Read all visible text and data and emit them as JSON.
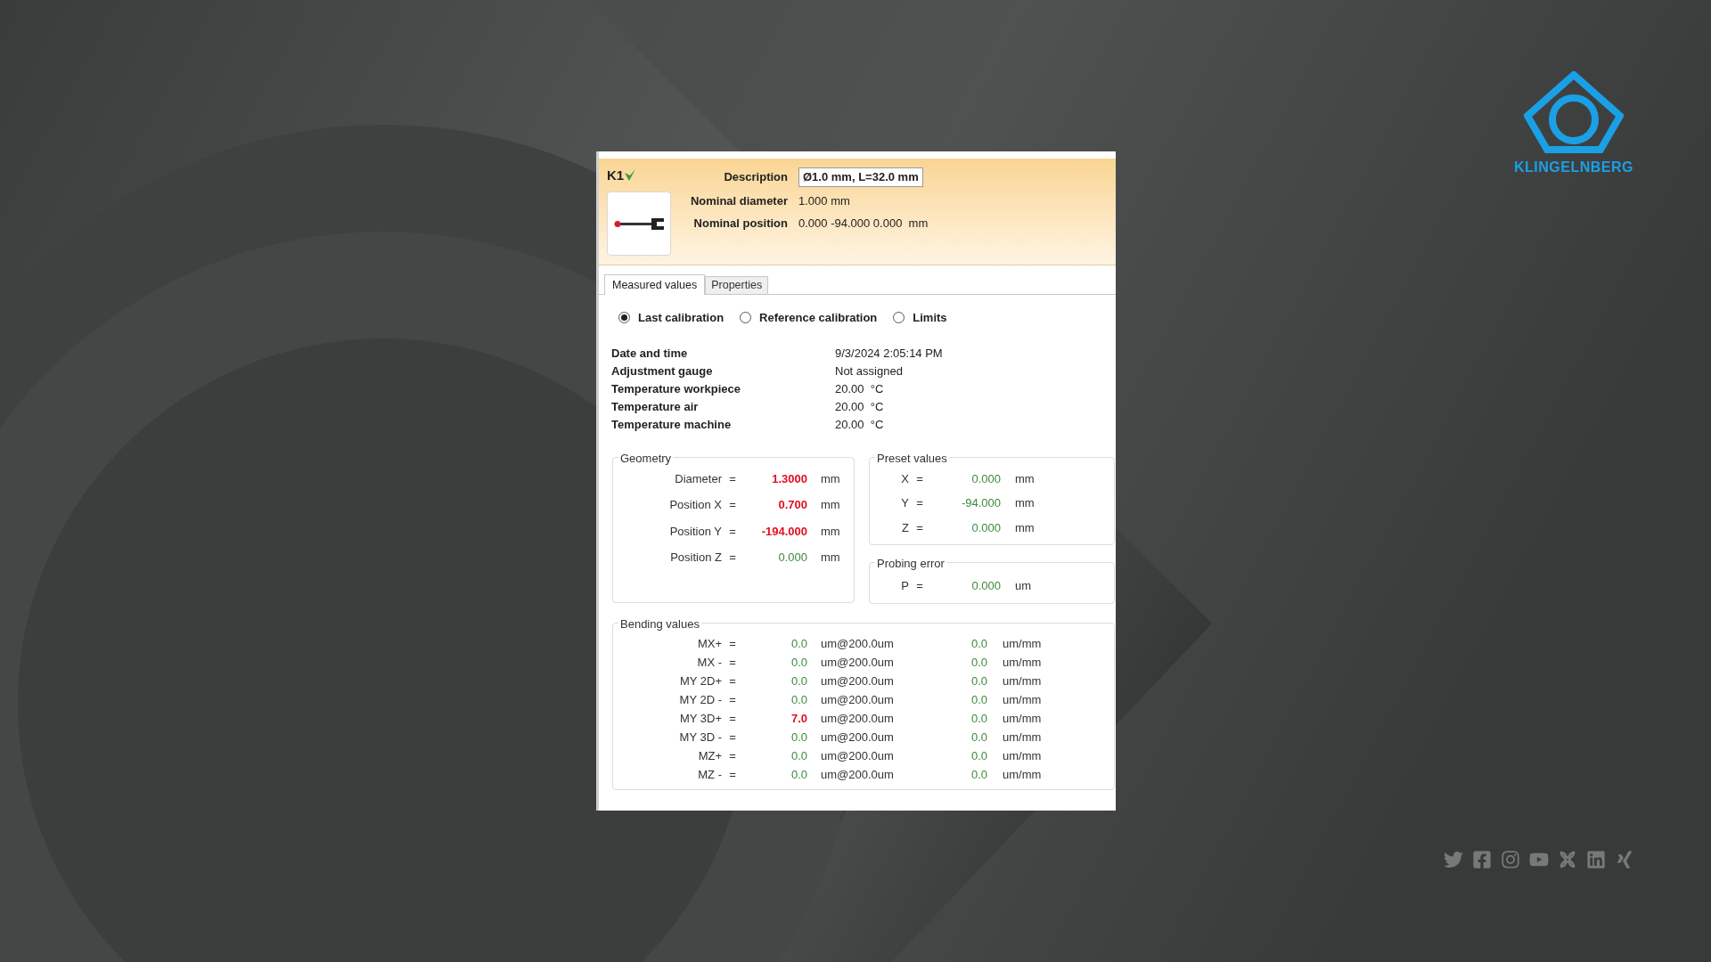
{
  "logo": {
    "text": "KLINGELNBERG"
  },
  "probe": {
    "name": "K1",
    "description_label": "Description",
    "description": "Ø1.0 mm, L=32.0 mm",
    "fields": [
      {
        "label": "Nominal diameter",
        "value": "1.000 mm"
      },
      {
        "label": "Nominal position",
        "value": "0.000 -94.000 0.000  mm"
      }
    ]
  },
  "tabs": [
    {
      "label": "Measured values",
      "selected": true
    },
    {
      "label": "Properties",
      "selected": false
    }
  ],
  "calibration_options": [
    {
      "label": "Last calibration",
      "selected": true
    },
    {
      "label": "Reference calibration",
      "selected": false
    },
    {
      "label": "Limits",
      "selected": false
    }
  ],
  "info": [
    {
      "label": "Date and time",
      "value": "9/3/2024 2:05:14 PM"
    },
    {
      "label": "Adjustment gauge",
      "value": "Not assigned"
    },
    {
      "label": "Temperature workpiece",
      "value": "20.00  °C"
    },
    {
      "label": "Temperature air",
      "value": "20.00  °C"
    },
    {
      "label": "Temperature machine",
      "value": "20.00  °C"
    }
  ],
  "geometry": {
    "title": "Geometry",
    "rows": [
      {
        "label": "Diameter",
        "eq": "=",
        "value": "1.3000",
        "unit": "mm",
        "out_of_tolerance": true
      },
      {
        "label": "Position X",
        "eq": "=",
        "value": "0.700",
        "unit": "mm",
        "out_of_tolerance": true
      },
      {
        "label": "Position Y",
        "eq": "=",
        "value": "-194.000",
        "unit": "mm",
        "out_of_tolerance": true
      },
      {
        "label": "Position Z",
        "eq": "=",
        "value": "0.000",
        "unit": "mm",
        "out_of_tolerance": false
      }
    ]
  },
  "preset_values": {
    "title": "Preset values",
    "rows": [
      {
        "label": "X",
        "eq": "=",
        "value": "0.000",
        "unit": "mm",
        "out_of_tolerance": false
      },
      {
        "label": "Y",
        "eq": "=",
        "value": "-94.000",
        "unit": "mm",
        "out_of_tolerance": false
      },
      {
        "label": "Z",
        "eq": "=",
        "value": "0.000",
        "unit": "mm",
        "out_of_tolerance": false
      }
    ]
  },
  "probing_error": {
    "title": "Probing error",
    "rows": [
      {
        "label": "P",
        "eq": "=",
        "value": "0.000",
        "unit": "um",
        "out_of_tolerance": false
      }
    ]
  },
  "bending_values": {
    "title": "Bending values",
    "rows": [
      {
        "label": "MX+",
        "eq": "=",
        "value": "0.0",
        "unit": "um@200.0um",
        "out_of_tolerance": false,
        "value_2": "0.0",
        "unit_2": "um/mm"
      },
      {
        "label": "MX -",
        "eq": "=",
        "value": "0.0",
        "unit": "um@200.0um",
        "out_of_tolerance": false,
        "value_2": "0.0",
        "unit_2": "um/mm"
      },
      {
        "label": "MY 2D+",
        "eq": "=",
        "value": "0.0",
        "unit": "um@200.0um",
        "out_of_tolerance": false,
        "value_2": "0.0",
        "unit_2": "um/mm"
      },
      {
        "label": "MY 2D -",
        "eq": "=",
        "value": "0.0",
        "unit": "um@200.0um",
        "out_of_tolerance": false,
        "value_2": "0.0",
        "unit_2": "um/mm"
      },
      {
        "label": "MY 3D+",
        "eq": "=",
        "value": "7.0",
        "unit": "um@200.0um",
        "out_of_tolerance": true,
        "value_2": "0.0",
        "unit_2": "um/mm"
      },
      {
        "label": "MY 3D -",
        "eq": "=",
        "value": "0.0",
        "unit": "um@200.0um",
        "out_of_tolerance": false,
        "value_2": "0.0",
        "unit_2": "um/mm"
      },
      {
        "label": "MZ+",
        "eq": "=",
        "value": "0.0",
        "unit": "um@200.0um",
        "out_of_tolerance": false,
        "value_2": "0.0",
        "unit_2": "um/mm"
      },
      {
        "label": "MZ -",
        "eq": "=",
        "value": "0.0",
        "unit": "um@200.0um",
        "out_of_tolerance": false,
        "value_2": "0.0",
        "unit_2": "um/mm"
      }
    ]
  }
}
